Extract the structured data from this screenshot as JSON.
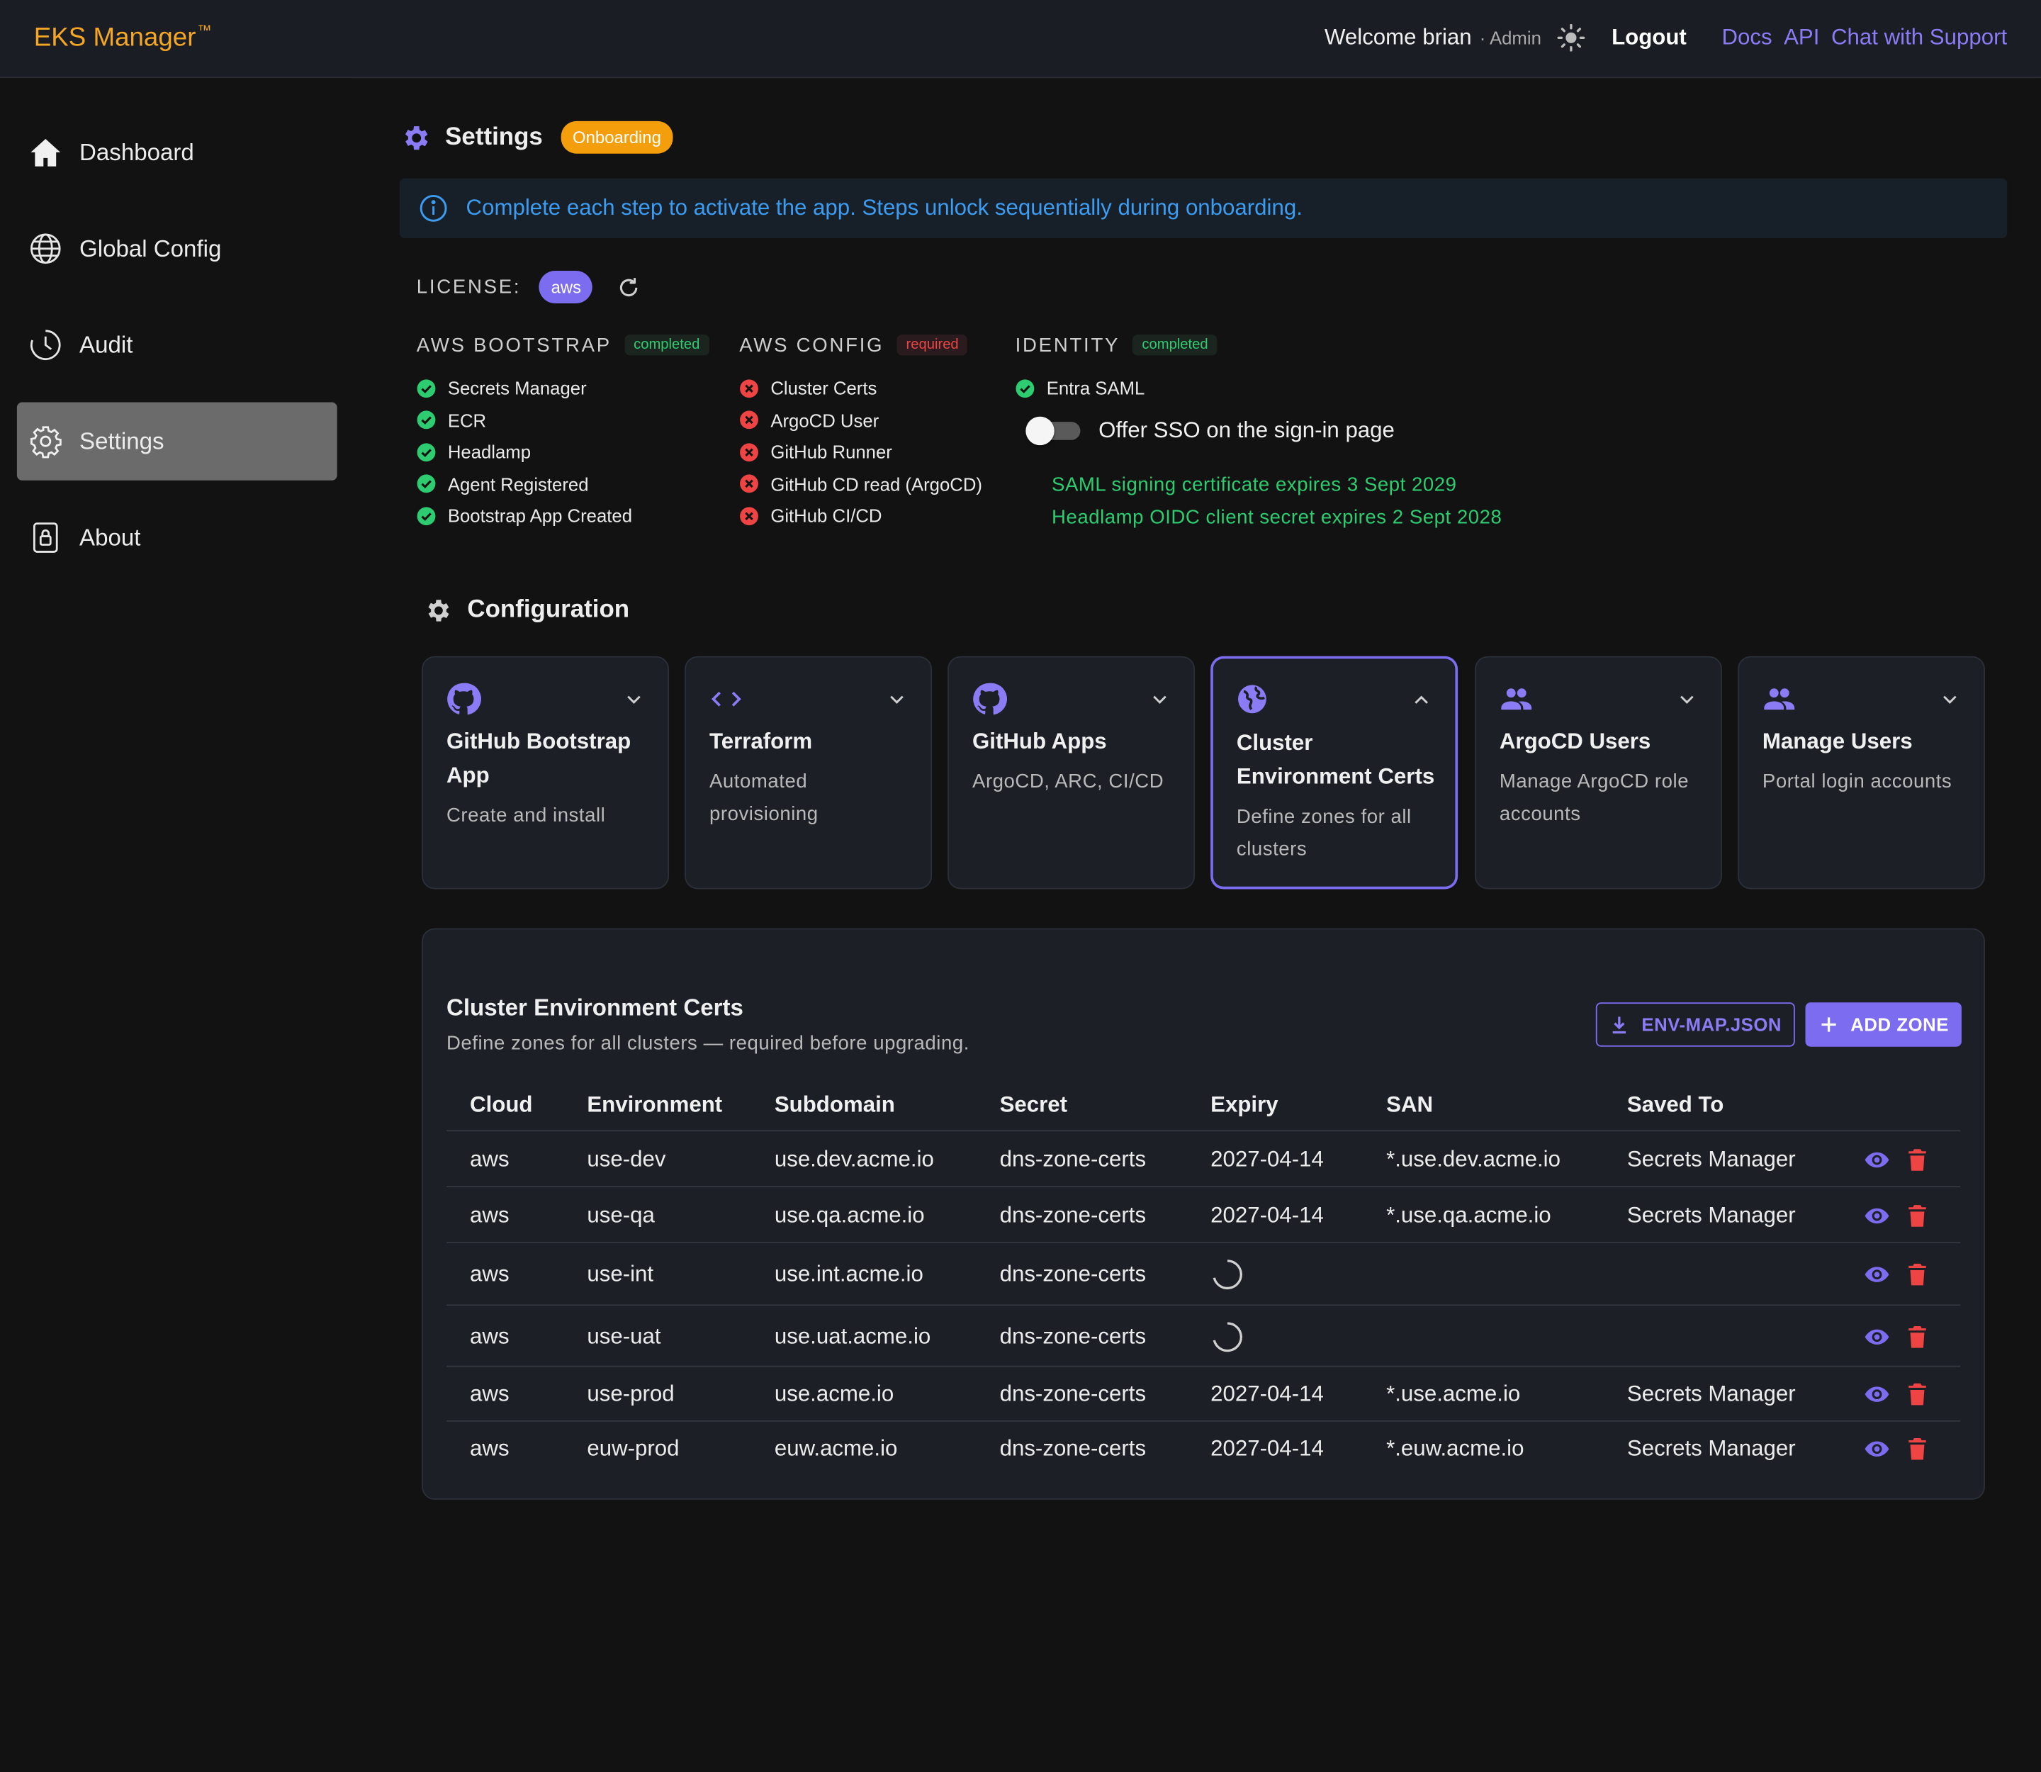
{
  "app": {
    "name": "EKS Manager",
    "tm": "™"
  },
  "header": {
    "welcome": "Welcome brian",
    "role": "· Admin",
    "theme_icon": "sun-icon",
    "logout": "Logout",
    "links": [
      "Docs",
      "API",
      "Chat with Support"
    ]
  },
  "sidebar": {
    "items": [
      {
        "label": "Dashboard",
        "icon": "home-icon",
        "active": false
      },
      {
        "label": "Global Config",
        "icon": "globe-icon",
        "active": false
      },
      {
        "label": "Audit",
        "icon": "clock-icon",
        "active": false
      },
      {
        "label": "Settings",
        "icon": "gear-icon",
        "active": true
      },
      {
        "label": "About",
        "icon": "lock-icon",
        "active": false
      }
    ]
  },
  "settings": {
    "title": "Settings",
    "badge": "Onboarding",
    "info": "Complete each step to activate the app. Steps unlock sequentially during onboarding.",
    "license_label": "LICENSE:",
    "license_value": "aws"
  },
  "sections": [
    {
      "title": "AWS BOOTSTRAP",
      "status": "completed",
      "items": [
        {
          "label": "Secrets Manager",
          "ok": true
        },
        {
          "label": "ECR",
          "ok": true
        },
        {
          "label": "Headlamp",
          "ok": true
        },
        {
          "label": "Agent Registered",
          "ok": true
        },
        {
          "label": "Bootstrap App Created",
          "ok": true
        }
      ]
    },
    {
      "title": "AWS CONFIG",
      "status": "required",
      "items": [
        {
          "label": "Cluster Certs",
          "ok": false
        },
        {
          "label": "ArgoCD User",
          "ok": false
        },
        {
          "label": "GitHub Runner",
          "ok": false
        },
        {
          "label": "GitHub CD read (ArgoCD)",
          "ok": false
        },
        {
          "label": "GitHub CI/CD",
          "ok": false
        }
      ]
    },
    {
      "title": "IDENTITY",
      "status": "completed",
      "items": [
        {
          "label": "Entra SAML",
          "ok": true
        }
      ]
    }
  ],
  "identity": {
    "sso_label": "Offer SSO on the sign-in page",
    "sso_enabled": false,
    "expiry_lines": [
      "SAML signing certificate expires 3 Sept 2029",
      "Headlamp OIDC client secret expires 2 Sept 2028"
    ]
  },
  "configuration": {
    "title": "Configuration",
    "cards": [
      {
        "title": "GitHub Bootstrap App",
        "desc": "Create and install",
        "icon": "github-icon",
        "expanded": false
      },
      {
        "title": "Terraform",
        "desc": "Automated provisioning",
        "icon": "code-icon",
        "expanded": false
      },
      {
        "title": "GitHub Apps",
        "desc": "ArgoCD, ARC, CI/CD",
        "icon": "github-icon",
        "expanded": false
      },
      {
        "title": "Cluster Environment Certs",
        "desc": "Define zones for all clusters",
        "icon": "globe-icon",
        "expanded": true
      },
      {
        "title": "ArgoCD Users",
        "desc": "Manage ArgoCD role accounts",
        "icon": "people-icon",
        "expanded": false
      },
      {
        "title": "Manage Users",
        "desc": "Portal login accounts",
        "icon": "people-icon",
        "expanded": false
      }
    ]
  },
  "certs": {
    "title": "Cluster Environment Certs",
    "subtitle": "Define zones for all clusters — required before upgrading.",
    "env_button": "ENV-MAP.JSON",
    "add_button": "ADD ZONE",
    "columns": [
      "Cloud",
      "Environment",
      "Subdomain",
      "Secret",
      "Expiry",
      "SAN",
      "Saved To"
    ],
    "rows": [
      {
        "cloud": "aws",
        "env": "use-dev",
        "subdomain": "use.dev.acme.io",
        "secret": "dns-zone-certs",
        "expiry": "2027-04-14",
        "san": "*.use.dev.acme.io",
        "saved": "Secrets Manager",
        "loading": false
      },
      {
        "cloud": "aws",
        "env": "use-qa",
        "subdomain": "use.qa.acme.io",
        "secret": "dns-zone-certs",
        "expiry": "2027-04-14",
        "san": "*.use.qa.acme.io",
        "saved": "Secrets Manager",
        "loading": false
      },
      {
        "cloud": "aws",
        "env": "use-int",
        "subdomain": "use.int.acme.io",
        "secret": "dns-zone-certs",
        "expiry": "",
        "san": "",
        "saved": "",
        "loading": true
      },
      {
        "cloud": "aws",
        "env": "use-uat",
        "subdomain": "use.uat.acme.io",
        "secret": "dns-zone-certs",
        "expiry": "",
        "san": "",
        "saved": "",
        "loading": true
      },
      {
        "cloud": "aws",
        "env": "use-prod",
        "subdomain": "use.acme.io",
        "secret": "dns-zone-certs",
        "expiry": "2027-04-14",
        "san": "*.use.acme.io",
        "saved": "Secrets Manager",
        "loading": false
      },
      {
        "cloud": "aws",
        "env": "euw-prod",
        "subdomain": "euw.acme.io",
        "secret": "dns-zone-certs",
        "expiry": "2027-04-14",
        "san": "*.euw.acme.io",
        "saved": "Secrets Manager",
        "loading": false
      }
    ]
  },
  "colors": {
    "accent": "#7c6cf0",
    "brand": "#f5a623",
    "ok": "#2ecc71",
    "error": "#ef4444",
    "info": "#3b9cf2",
    "delete": "#ef4444"
  }
}
